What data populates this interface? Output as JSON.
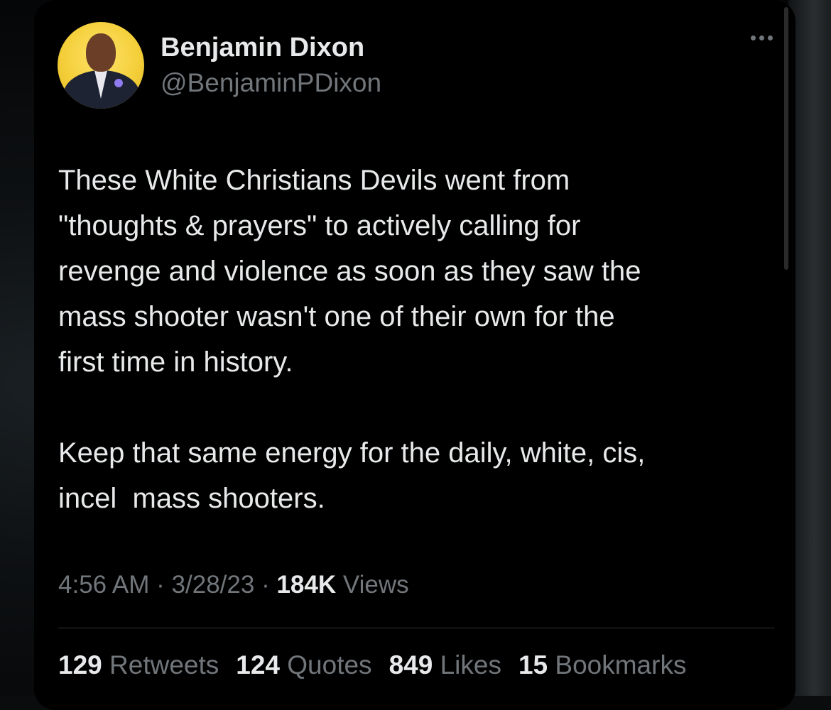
{
  "tweet": {
    "author": {
      "name": "Benjamin Dixon",
      "handle": "@BenjaminPDixon"
    },
    "paragraphs": [
      "These White Christians Devils went from\n\"thoughts & prayers\" to actively calling for\nrevenge and violence as soon as they saw the\nmass shooter wasn't one of their own for the\nfirst time in history.",
      "Keep that same energy for the daily, white, cis,\nincel  mass shooters."
    ],
    "time": "4:56 AM",
    "date": "3/28/23",
    "separator": "·",
    "views_count": "184K",
    "views_label": "Views",
    "stats": {
      "retweets": {
        "count": "129",
        "label": "Retweets"
      },
      "quotes": {
        "count": "124",
        "label": "Quotes"
      },
      "likes": {
        "count": "849",
        "label": "Likes"
      },
      "bookmarks": {
        "count": "15",
        "label": "Bookmarks"
      }
    }
  },
  "icons": {
    "more": "more-dots-icon"
  },
  "colors": {
    "background": "#000000",
    "primary_text": "#e7e9ea",
    "secondary_text": "#71767b",
    "divider": "#2f3336"
  }
}
